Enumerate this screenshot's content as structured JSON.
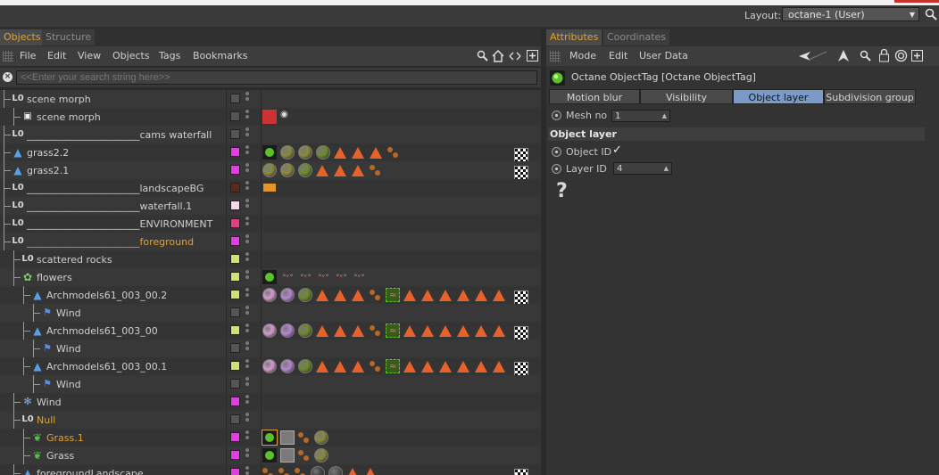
{
  "layout": {
    "label": "Layout:",
    "value": "octane-1 (User)"
  },
  "left_panel": {
    "tabs": [
      "Objects",
      "Structure"
    ],
    "menu": [
      "File",
      "Edit",
      "View",
      "Objects",
      "Tags",
      "Bookmarks"
    ],
    "search_placeholder": "<<Enter your search string here>>"
  },
  "objects": [
    {
      "name": "scene morph",
      "indent": 0,
      "icon": "null-icon",
      "layer_color": "#555555",
      "tags": "none",
      "highlight": false
    },
    {
      "name": "scene morph",
      "indent": 1,
      "icon": "camera-icon",
      "layer_color": "#555555",
      "tags": "camera",
      "highlight": false
    },
    {
      "name": "_______________________cams waterfall",
      "indent": 0,
      "icon": "null-icon",
      "layer_color": "#555555",
      "tags": "none",
      "highlight": false
    },
    {
      "name": "grass2.2",
      "indent": 0,
      "icon": "landscape-icon",
      "layer_color": "#e040e0",
      "tags": "grass_a",
      "highlight": false
    },
    {
      "name": "grass2.1",
      "indent": 0,
      "icon": "landscape-icon",
      "layer_color": "#e040e0",
      "tags": "grass_b",
      "highlight": false
    },
    {
      "name": "_______________________landscapeBG",
      "indent": 0,
      "icon": "null-icon",
      "layer_color": "#5a2a1a",
      "tags": "display",
      "highlight": false
    },
    {
      "name": "_______________________waterfall.1",
      "indent": 0,
      "icon": "null-icon",
      "layer_color": "#f5d8e8",
      "tags": "none",
      "highlight": false
    },
    {
      "name": "_______________________ENVIRONMENT",
      "indent": 0,
      "icon": "null-icon",
      "layer_color": "#e04080",
      "tags": "none",
      "highlight": false
    },
    {
      "name": "_______________________foreground",
      "indent": 0,
      "icon": "null-icon",
      "layer_color": "#e040e0",
      "tags": "none",
      "highlight": true
    },
    {
      "name": "scattered rocks",
      "indent": 1,
      "icon": "null-icon",
      "layer_color": "#cfe27a",
      "tags": "none",
      "highlight": false
    },
    {
      "name": "flowers",
      "indent": 1,
      "icon": "cloner-icon",
      "layer_color": "#cfe27a",
      "tags": "flowers",
      "highlight": false
    },
    {
      "name": "Archmodels61_003_00.2",
      "indent": 2,
      "icon": "landscape-icon",
      "layer_color": "#cfe27a",
      "tags": "arch",
      "highlight": false
    },
    {
      "name": "Wind",
      "indent": 3,
      "icon": "flag-icon",
      "layer_color": "#555555",
      "tags": "none",
      "highlight": false
    },
    {
      "name": "Archmodels61_003_00",
      "indent": 2,
      "icon": "landscape-icon",
      "layer_color": "#cfe27a",
      "tags": "arch",
      "highlight": false
    },
    {
      "name": "Wind",
      "indent": 3,
      "icon": "flag-icon",
      "layer_color": "#555555",
      "tags": "none",
      "highlight": false
    },
    {
      "name": "Archmodels61_003_00.1",
      "indent": 2,
      "icon": "landscape-icon",
      "layer_color": "#cfe27a",
      "tags": "arch",
      "highlight": false
    },
    {
      "name": "Wind",
      "indent": 3,
      "icon": "flag-icon",
      "layer_color": "#555555",
      "tags": "none",
      "highlight": false
    },
    {
      "name": "Wind",
      "indent": 1,
      "icon": "wind-icon",
      "layer_color": "#e040e0",
      "tags": "none",
      "highlight": false
    },
    {
      "name": "Null",
      "indent": 1,
      "icon": "null-icon",
      "layer_color": "#555555",
      "tags": "none",
      "highlight": true
    },
    {
      "name": "Grass.1",
      "indent": 2,
      "icon": "grass-icon",
      "layer_color": "#e040e0",
      "tags": "grass_sel",
      "highlight": true
    },
    {
      "name": "Grass",
      "indent": 2,
      "icon": "grass-icon",
      "layer_color": "#e040e0",
      "tags": "grass_plain",
      "highlight": false
    },
    {
      "name": "foregroundLandscape",
      "indent": 1,
      "icon": "landscape-icon",
      "layer_color": "#e040e0",
      "tags": "fg",
      "highlight": false
    }
  ],
  "right_panel": {
    "tabs": [
      "Attributes",
      "Coordinates"
    ],
    "menu": [
      "Mode",
      "Edit",
      "User Data"
    ],
    "tag_title": "Octane ObjectTag [Octane ObjectTag]",
    "subtabs": [
      "Motion blur",
      "Visibility",
      "Object layer",
      "Subdivision group"
    ],
    "active_subtab": "Object layer",
    "mesh_no": {
      "label": "Mesh no",
      "value": "1"
    },
    "section": "Object layer",
    "object_id": {
      "label": "Object ID",
      "checked": "✓"
    },
    "layer_id": {
      "label": "Layer ID",
      "value": "4"
    },
    "help": "?"
  }
}
